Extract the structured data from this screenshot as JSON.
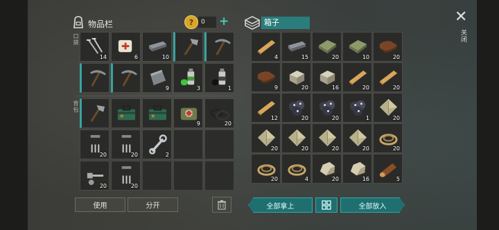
{
  "inventory": {
    "title": "物品栏",
    "coins": "0",
    "pocket_label": "口袋",
    "backpack_label": "背包",
    "pocket": [
      {
        "icon": "nails-icon",
        "count": "14",
        "sel": false
      },
      {
        "icon": "bandage-icon",
        "count": "6",
        "sel": false
      },
      {
        "icon": "iron-bar-icon",
        "count": "10",
        "sel": false
      },
      {
        "icon": "hatchet-icon",
        "count": "",
        "sel": true
      },
      {
        "icon": "pickaxe-icon",
        "count": "",
        "sel": true
      },
      {
        "icon": "pickaxe-icon",
        "count": "",
        "sel": true
      },
      {
        "icon": "pickaxe-icon",
        "count": "",
        "sel": true
      },
      {
        "icon": "metal-plate-icon",
        "count": "9",
        "sel": false
      },
      {
        "icon": "spray-can-green-icon",
        "count": "3",
        "sel": false
      },
      {
        "icon": "spray-can-black-icon",
        "count": "1",
        "sel": false
      }
    ],
    "backpack": [
      {
        "icon": "hatchet-icon",
        "count": "",
        "sel": true
      },
      {
        "icon": "toolbox-icon",
        "count": "",
        "sel": false
      },
      {
        "icon": "toolbox-icon",
        "count": "",
        "sel": false
      },
      {
        "icon": "medkit-bag-icon",
        "count": "9",
        "sel": false
      },
      {
        "icon": "wires-icon",
        "count": "20",
        "sel": false
      },
      {
        "icon": "transistor-icon",
        "count": "20",
        "sel": false
      },
      {
        "icon": "transistor-icon",
        "count": "20",
        "sel": false
      },
      {
        "icon": "wrench-icon",
        "count": "2",
        "sel": false
      },
      {
        "icon": "",
        "count": "",
        "sel": false
      },
      {
        "icon": "",
        "count": "",
        "sel": false
      },
      {
        "icon": "bolts-icon",
        "count": "20",
        "sel": false
      },
      {
        "icon": "transistor-icon",
        "count": "20",
        "sel": false
      },
      {
        "icon": "",
        "count": "",
        "sel": false
      },
      {
        "icon": "",
        "count": "",
        "sel": false
      },
      {
        "icon": "",
        "count": "",
        "sel": false
      }
    ],
    "use_label": "使用",
    "split_label": "分开"
  },
  "chest": {
    "title": "箱子",
    "close_label": "关闭",
    "items": [
      {
        "icon": "wood-plank-icon",
        "count": "4"
      },
      {
        "icon": "iron-bar-icon",
        "count": "15"
      },
      {
        "icon": "cloth-icon",
        "count": "20"
      },
      {
        "icon": "cloth-icon",
        "count": "10"
      },
      {
        "icon": "leather-icon",
        "count": "20"
      },
      {
        "icon": "leather-icon",
        "count": "9"
      },
      {
        "icon": "stone-block-icon",
        "count": "20"
      },
      {
        "icon": "stone-block-icon",
        "count": "16"
      },
      {
        "icon": "wood-plank-icon",
        "count": "20"
      },
      {
        "icon": "wood-plank-icon",
        "count": "20"
      },
      {
        "icon": "wood-plank-icon",
        "count": "12"
      },
      {
        "icon": "ore-icon",
        "count": "20"
      },
      {
        "icon": "ore-icon",
        "count": "20"
      },
      {
        "icon": "ore-icon",
        "count": "1"
      },
      {
        "icon": "fiber-bundle-icon",
        "count": "20"
      },
      {
        "icon": "fiber-bundle-icon",
        "count": "20"
      },
      {
        "icon": "fiber-bundle-icon",
        "count": "20"
      },
      {
        "icon": "fiber-bundle-icon",
        "count": "20"
      },
      {
        "icon": "fiber-bundle-icon",
        "count": "20"
      },
      {
        "icon": "rope-icon",
        "count": "20"
      },
      {
        "icon": "rope-icon",
        "count": "20"
      },
      {
        "icon": "rope-icon",
        "count": "4"
      },
      {
        "icon": "rock-icon",
        "count": "20"
      },
      {
        "icon": "rock-icon",
        "count": "16"
      },
      {
        "icon": "log-icon",
        "count": "5"
      }
    ],
    "take_all_label": "全部拿上",
    "put_all_label": "全部放入"
  },
  "colors": {
    "accent": "#2b7d7d",
    "select": "#3aa3a0"
  }
}
